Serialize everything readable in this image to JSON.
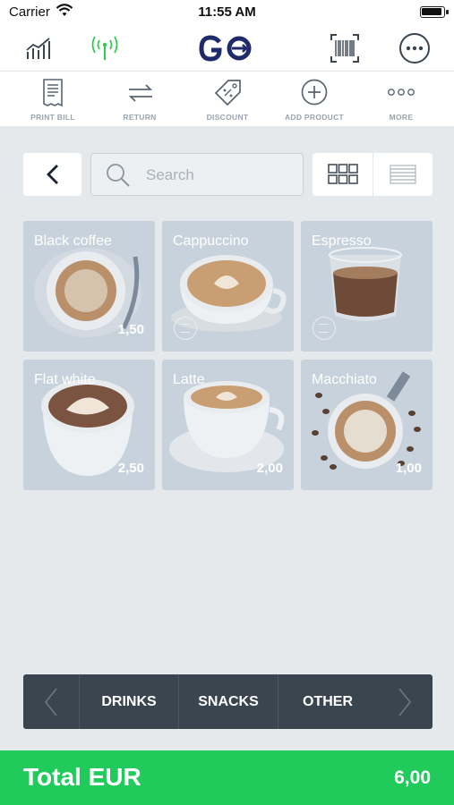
{
  "status_bar": {
    "carrier": "Carrier",
    "time": "11:55 AM"
  },
  "top_bar": {
    "logo": "GO",
    "icons": [
      "stats-icon",
      "signal-icon",
      "barcode-icon",
      "more-circle-icon"
    ]
  },
  "actions": [
    {
      "label": "PRINT BILL",
      "icon": "receipt-icon"
    },
    {
      "label": "RETURN",
      "icon": "return-icon"
    },
    {
      "label": "DISCOUNT",
      "icon": "tag-icon"
    },
    {
      "label": "ADD PRODUCT",
      "icon": "plus-circle-icon"
    },
    {
      "label": "MORE",
      "icon": "dots-icon"
    }
  ],
  "search": {
    "placeholder": "Search"
  },
  "products": [
    {
      "name": "Black coffee",
      "price": "1,50"
    },
    {
      "name": "Cappuccino",
      "price": ""
    },
    {
      "name": "Espresso",
      "price": ""
    },
    {
      "name": "Flat white",
      "price": "2,50"
    },
    {
      "name": "Latte",
      "price": "2,00"
    },
    {
      "name": "Macchiato",
      "price": "1,00"
    }
  ],
  "categories": [
    "DRINKS",
    "SNACKS",
    "OTHER"
  ],
  "total": {
    "label": "Total EUR",
    "value": "6,00"
  },
  "colors": {
    "accent_green": "#21cb5b",
    "category_bar": "#3b4550",
    "product_tile": "#c7d2dc",
    "logo_blue": "#1f2a6b"
  }
}
